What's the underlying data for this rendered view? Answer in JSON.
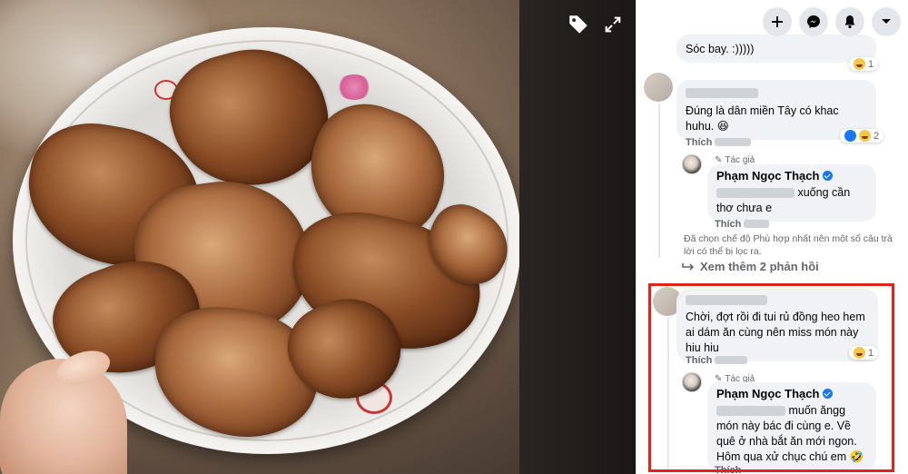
{
  "viewer": {
    "tag_icon": "tag-icon",
    "fullscreen_icon": "expand-icon"
  },
  "topbar": {
    "icons": [
      "plus-icon",
      "messenger-icon",
      "bell-icon",
      "caret-down-icon"
    ]
  },
  "comments": [
    {
      "text": "Sóc bay. :)))))",
      "reaction_count": "1"
    },
    {
      "text": "Đúng là dân miền Tây có khac huhu. 😆",
      "action": "Thích",
      "reaction_count": "2"
    }
  ],
  "author_reply_1": {
    "tag": "Tác giả",
    "name": "Phạm Ngọc Thạch",
    "text_after_blur": "xuống cần thơ chưa e",
    "action": "Thích"
  },
  "filter_note": "Đã chọn chế độ Phù hợp nhất nên một số câu trả lời có thể bị lọc ra.",
  "more_replies": "Xem thêm 2 phản hồi",
  "highlighted_comment": {
    "text": "Chời, đợt rồi đi tui rủ đồng heo hem ai dám ăn cùng nên miss món này hiu hiu",
    "reaction_count": "1",
    "action": "Thích"
  },
  "author_reply_2": {
    "tag": "Tác giả",
    "name": "Phạm Ngọc Thạch",
    "text_after_blur": "muốn ăngg món này bác đi cùng e. Về quê ở nhà bắt ăn mới ngon. Hôm qua xử chục chú em 🤣",
    "action": "Thích"
  },
  "colors": {
    "highlight_border": "#e0241b",
    "bubble_bg": "#f0f2f5",
    "link_blue": "#1877f2"
  }
}
